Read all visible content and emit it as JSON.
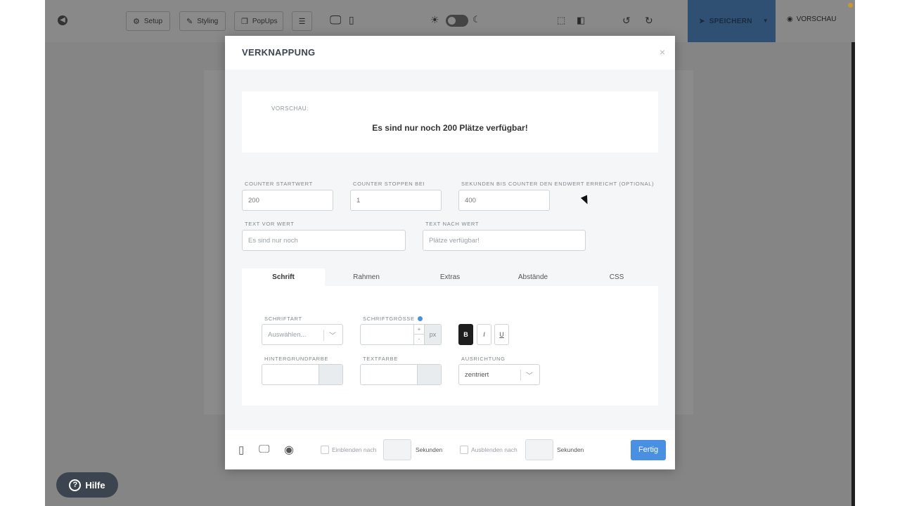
{
  "toolbar": {
    "setup_label": "Setup",
    "styling_label": "Styling",
    "popups_label": "PopUps",
    "save_label": "SPEICHERN",
    "preview_label": "VORSCHAU"
  },
  "help": {
    "label": "Hilfe"
  },
  "modal": {
    "title": "VERKNAPPUNG",
    "close_glyph": "×",
    "preview_label": "VORSCHAU:",
    "preview_text": "Es sind nur noch 200 Plätze verfügbar!",
    "fields": {
      "counter_start_label": "COUNTER STARTWERT",
      "counter_start_value": "200",
      "counter_stop_label": "COUNTER STOPPEN BEI",
      "counter_stop_value": "1",
      "seconds_label": "SEKUNDEN BIS COUNTER DEN ENDWERT ERREICHT (OPTIONAL)",
      "seconds_value": "400",
      "text_before_label": "TEXT VOR WERT",
      "text_before_value": "Es sind nur noch",
      "text_after_label": "TEXT NACH WERT",
      "text_after_value": "Plätze verfügbar!"
    },
    "tabs": [
      "Schrift",
      "Rahmen",
      "Extras",
      "Abstände",
      "CSS"
    ],
    "font": {
      "font_family_label": "SCHRIFTART",
      "font_family_placeholder": "Auswählen...",
      "font_size_label": "SCHRIFTGRÖSSE",
      "font_size_unit": "px",
      "plus": "+",
      "minus": "-",
      "bold": "B",
      "italic": "I",
      "underline": "U",
      "bg_color_label": "HINTERGRUNDFARBE",
      "text_color_label": "TEXTFARBE",
      "alignment_label": "AUSRICHTUNG",
      "alignment_value": "zentriert"
    },
    "footer": {
      "show_after_label": "Einblenden nach",
      "show_after_unit": "Sekunden",
      "hide_after_label": "Ausblenden nach",
      "hide_after_unit": "Sekunden",
      "done_label": "Fertig"
    }
  },
  "colors": {
    "accent": "#4a90e2",
    "save_button": "#2f5073",
    "help_button": "#3c4450"
  }
}
